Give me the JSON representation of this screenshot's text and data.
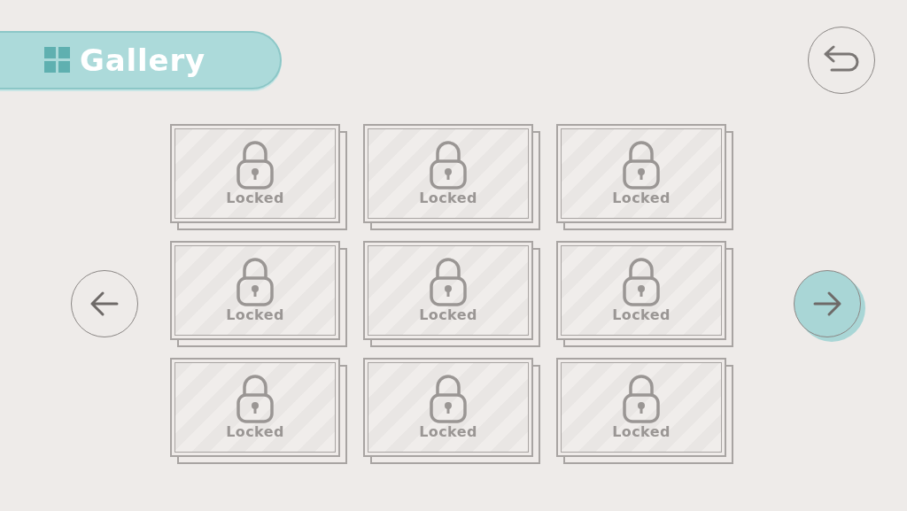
{
  "header": {
    "title": "Gallery"
  },
  "slots": [
    {
      "label": "Locked",
      "locked": true
    },
    {
      "label": "Locked",
      "locked": true
    },
    {
      "label": "Locked",
      "locked": true
    },
    {
      "label": "Locked",
      "locked": true
    },
    {
      "label": "Locked",
      "locked": true
    },
    {
      "label": "Locked",
      "locked": true
    },
    {
      "label": "Locked",
      "locked": true
    },
    {
      "label": "Locked",
      "locked": true
    },
    {
      "label": "Locked",
      "locked": true
    }
  ],
  "pager": [
    {
      "kind": "previous",
      "selected": false
    },
    {
      "kind": "next",
      "selected": true
    }
  ]
}
